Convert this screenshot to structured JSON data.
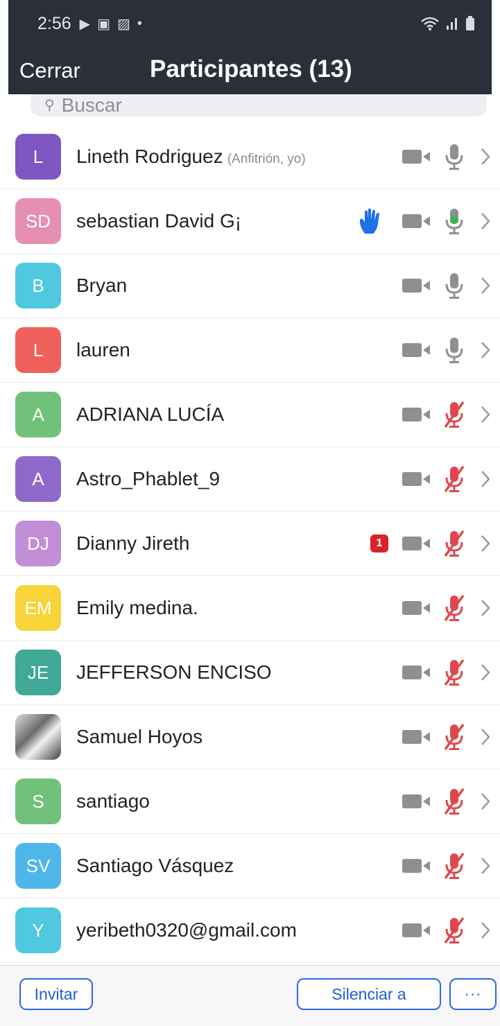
{
  "status_bar": {
    "time": "2:56",
    "icons_left": [
      "play-icon",
      "game-icon",
      "image-icon",
      "dot-icon"
    ],
    "icons_right": [
      "wifi-icon",
      "signal-icon",
      "battery-icon"
    ]
  },
  "header": {
    "close_label": "Cerrar",
    "title": "Participantes (13)"
  },
  "search": {
    "placeholder": "Buscar"
  },
  "colors": {
    "header_bg": "#2b2f3a",
    "accent_blue": "#2c69e0",
    "mic_active": "#3fb24f",
    "mic_muted": "#e0474c",
    "icon_gray": "#8e8e93"
  },
  "participants": [
    {
      "initials": "L",
      "name": "Lineth Rodriguez",
      "role": "(Anfitrión, yo)",
      "avatar_color": "#7e57c2",
      "mic": "on",
      "hand_raised": false,
      "badge": ""
    },
    {
      "initials": "SD",
      "name": "sebastian David G¡",
      "role": "",
      "avatar_color": "#e58fb3",
      "mic": "active",
      "hand_raised": true,
      "badge": ""
    },
    {
      "initials": "B",
      "name": "Bryan",
      "role": "",
      "avatar_color": "#4fc8e0",
      "mic": "on",
      "hand_raised": false,
      "badge": ""
    },
    {
      "initials": "L",
      "name": "lauren",
      "role": "",
      "avatar_color": "#f0605a",
      "mic": "on",
      "hand_raised": false,
      "badge": ""
    },
    {
      "initials": "A",
      "name": "ADRIANA  LUCÍA",
      "role": "",
      "avatar_color": "#72c17a",
      "mic": "muted",
      "hand_raised": false,
      "badge": ""
    },
    {
      "initials": "A",
      "name": "Astro_Phablet_9",
      "role": "",
      "avatar_color": "#8f69c9",
      "mic": "muted",
      "hand_raised": false,
      "badge": ""
    },
    {
      "initials": "DJ",
      "name": "Dianny Jireth",
      "role": "",
      "avatar_color": "#c38ed8",
      "mic": "muted",
      "hand_raised": false,
      "badge": "1"
    },
    {
      "initials": "EM",
      "name": "Emily medina.",
      "role": "",
      "avatar_color": "#f6d43a",
      "mic": "muted",
      "hand_raised": false,
      "badge": ""
    },
    {
      "initials": "JE",
      "name": "JEFFERSON ENCISO",
      "role": "",
      "avatar_color": "#3fa896",
      "mic": "muted",
      "hand_raised": false,
      "badge": ""
    },
    {
      "initials": "",
      "name": "Samuel Hoyos",
      "role": "",
      "avatar_color": "photo",
      "mic": "muted",
      "hand_raised": false,
      "badge": ""
    },
    {
      "initials": "S",
      "name": "santiago",
      "role": "",
      "avatar_color": "#72c17a",
      "mic": "muted",
      "hand_raised": false,
      "badge": ""
    },
    {
      "initials": "SV",
      "name": "Santiago Vásquez",
      "role": "",
      "avatar_color": "#4fb6ea",
      "mic": "muted",
      "hand_raised": false,
      "badge": ""
    },
    {
      "initials": "Y",
      "name": "yeribeth0320@gmail.com",
      "role": "",
      "avatar_color": "#4fc8e0",
      "mic": "muted",
      "hand_raised": false,
      "badge": ""
    }
  ],
  "footer": {
    "invite_label": "Invitar",
    "mute_all_label": "Silenciar a",
    "more_label": "···"
  }
}
